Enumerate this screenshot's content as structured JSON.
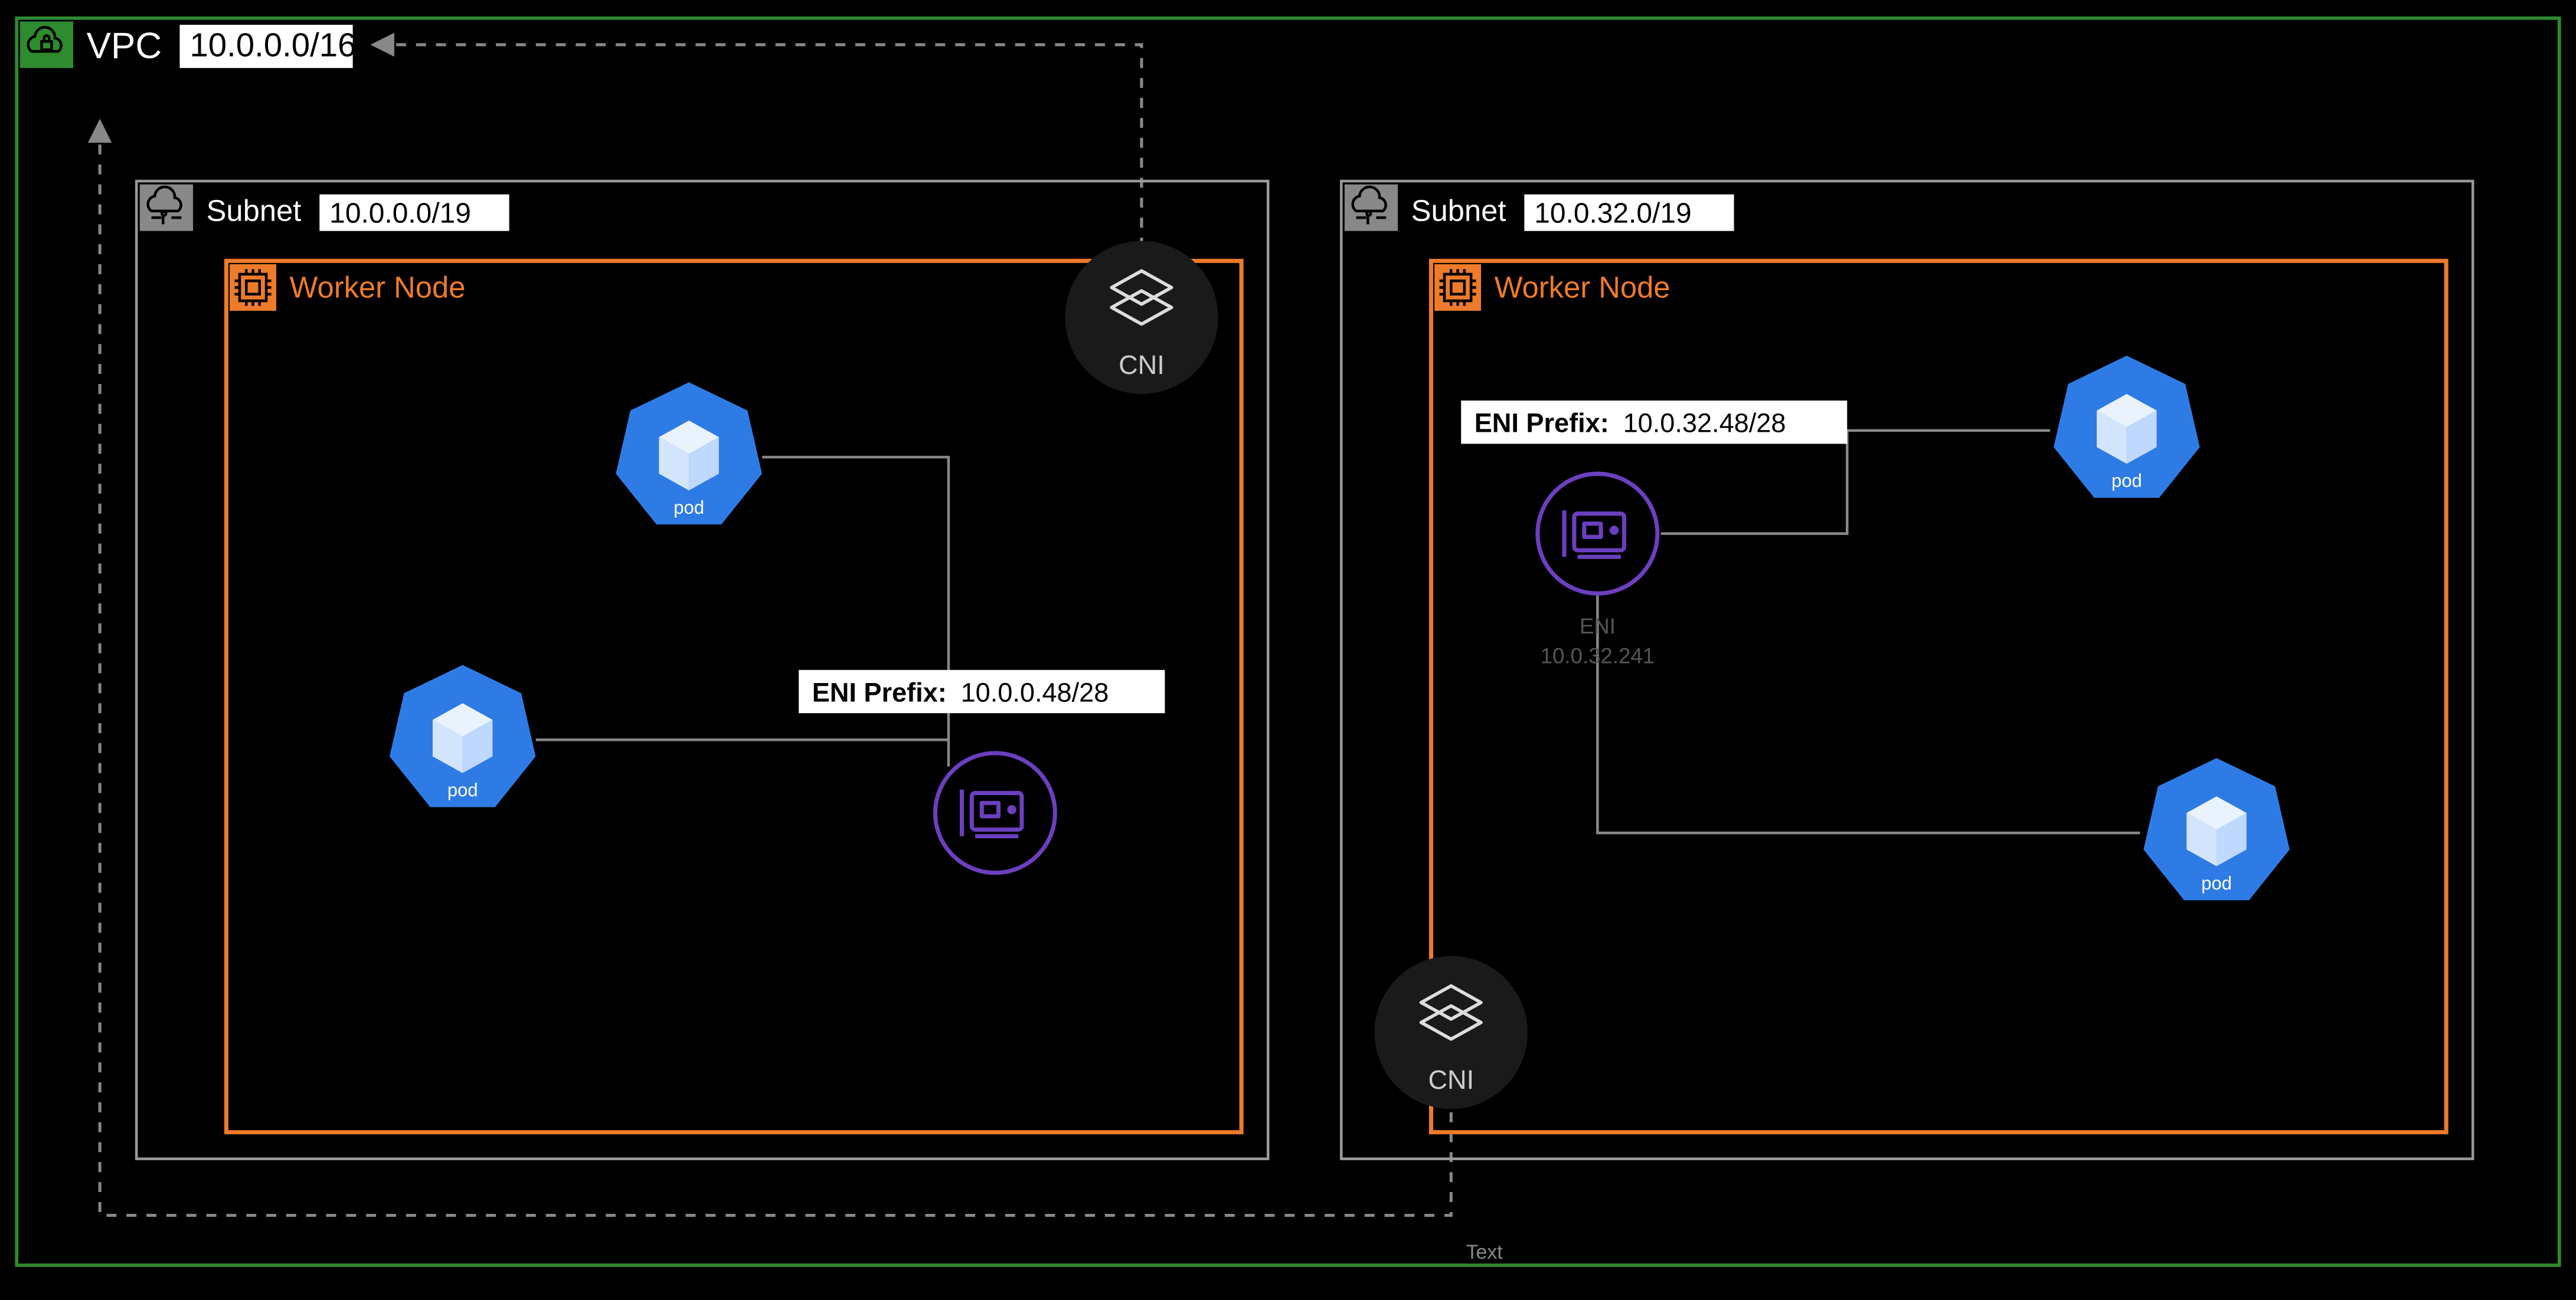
{
  "vpc": {
    "label": "VPC",
    "cidr": "10.0.0.0/16"
  },
  "subnets": [
    {
      "label": "Subnet",
      "cidr": "10.0.0.0/19",
      "worker_label": "Worker Node",
      "cni_label": "CNI",
      "eni_prefix_label": "ENI Prefix:",
      "eni_prefix_value": "10.0.0.48/28",
      "pods": [
        "pod",
        "pod"
      ]
    },
    {
      "label": "Subnet",
      "cidr": "10.0.32.0/19",
      "worker_label": "Worker Node",
      "cni_label": "CNI",
      "eni_prefix_label": "ENI Prefix:",
      "eni_prefix_value": "10.0.32.48/28",
      "eni_label": "ENI",
      "eni_ip": "10.0.32.241",
      "pods": [
        "pod",
        "pod"
      ]
    }
  ],
  "footer_text": "Text",
  "colors": {
    "vpc_border": "#2E8B2E",
    "subnet_border": "#888",
    "worker_border": "#ED7B29",
    "pod_fill": "#2F7BE5",
    "eni_stroke": "#6B3FBF",
    "cni_fill": "#1A1A1A"
  }
}
